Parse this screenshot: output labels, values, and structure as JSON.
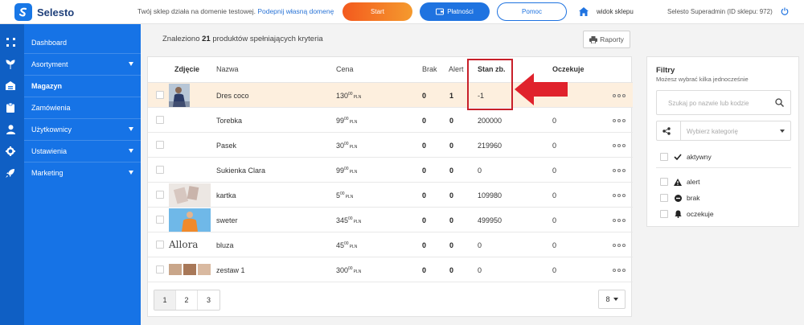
{
  "app": {
    "name": "Selesto"
  },
  "topbar": {
    "test_domain_text": "Twój sklep działa na domenie testowej.",
    "test_domain_link": "Podepnij własną domenę",
    "start_label": "Start",
    "payments_label": "Płatności",
    "help_label": "Pomoc",
    "view_shop_label": "widok sklepu",
    "account_label": "Selesto Superadmin (ID sklepu: 972)"
  },
  "sidebar": {
    "items": [
      {
        "label": "Dashboard"
      },
      {
        "label": "Asortyment"
      },
      {
        "label": "Magazyn"
      },
      {
        "label": "Zamówienia"
      },
      {
        "label": "Użytkownicy"
      },
      {
        "label": "Ustawienia"
      },
      {
        "label": "Marketing"
      }
    ]
  },
  "main": {
    "found_prefix": "Znaleziono",
    "found_count": "21",
    "found_suffix": "produktów spełniających kryteria",
    "reports_label": "Raporty"
  },
  "table": {
    "headers": {
      "photo": "Zdjęcie",
      "name": "Nazwa",
      "price": "Cena",
      "missing": "Brak",
      "alert": "Alert",
      "stock": "Stan zb.",
      "pending": "Oczekuje"
    },
    "rows": [
      {
        "name": "Dres coco",
        "price": "130",
        "cents": "00",
        "currency": "PLN",
        "missing": "0",
        "alert": "1",
        "stock": "-1",
        "pending": ""
      },
      {
        "name": "Torebka",
        "price": "99",
        "cents": "00",
        "currency": "PLN",
        "missing": "0",
        "alert": "0",
        "stock": "200000",
        "pending": "0"
      },
      {
        "name": "Pasek",
        "price": "30",
        "cents": "00",
        "currency": "PLN",
        "missing": "0",
        "alert": "0",
        "stock": "219960",
        "pending": "0"
      },
      {
        "name": "Sukienka Clara",
        "price": "99",
        "cents": "00",
        "currency": "PLN",
        "missing": "0",
        "alert": "0",
        "stock": "0",
        "pending": "0"
      },
      {
        "name": "kartka",
        "price": "5",
        "cents": "00",
        "currency": "PLN",
        "missing": "0",
        "alert": "0",
        "stock": "109980",
        "pending": "0"
      },
      {
        "name": "sweter",
        "price": "345",
        "cents": "00",
        "currency": "PLN",
        "missing": "0",
        "alert": "0",
        "stock": "499950",
        "pending": "0"
      },
      {
        "name": "bluza",
        "price": "45",
        "cents": "00",
        "currency": "PLN",
        "missing": "0",
        "alert": "0",
        "stock": "0",
        "pending": "0",
        "thumb_text": "Allora"
      },
      {
        "name": "zestaw 1",
        "price": "300",
        "cents": "00",
        "currency": "PLN",
        "missing": "0",
        "alert": "0",
        "stock": "0",
        "pending": "0"
      }
    ]
  },
  "pagination": {
    "pages": [
      "1",
      "2",
      "3"
    ],
    "per_page": "8"
  },
  "filters": {
    "title": "Filtry",
    "subtitle": "Możesz wybrać kilka jednocześnie",
    "search_placeholder": "Szukaj po nazwie lub kodzie",
    "category_placeholder": "Wybierz kategorię",
    "options": [
      {
        "label": "aktywny",
        "icon": "check-icon"
      },
      {
        "label": "alert",
        "icon": "warning-icon"
      },
      {
        "label": "brak",
        "icon": "minus-circle-icon"
      },
      {
        "label": "oczekuje",
        "icon": "bell-icon"
      }
    ]
  },
  "colors": {
    "accent": "#1673e6",
    "highlight_row": "#fdefde",
    "annotation": "#c8202a",
    "start_btn": "#f35a1e"
  }
}
